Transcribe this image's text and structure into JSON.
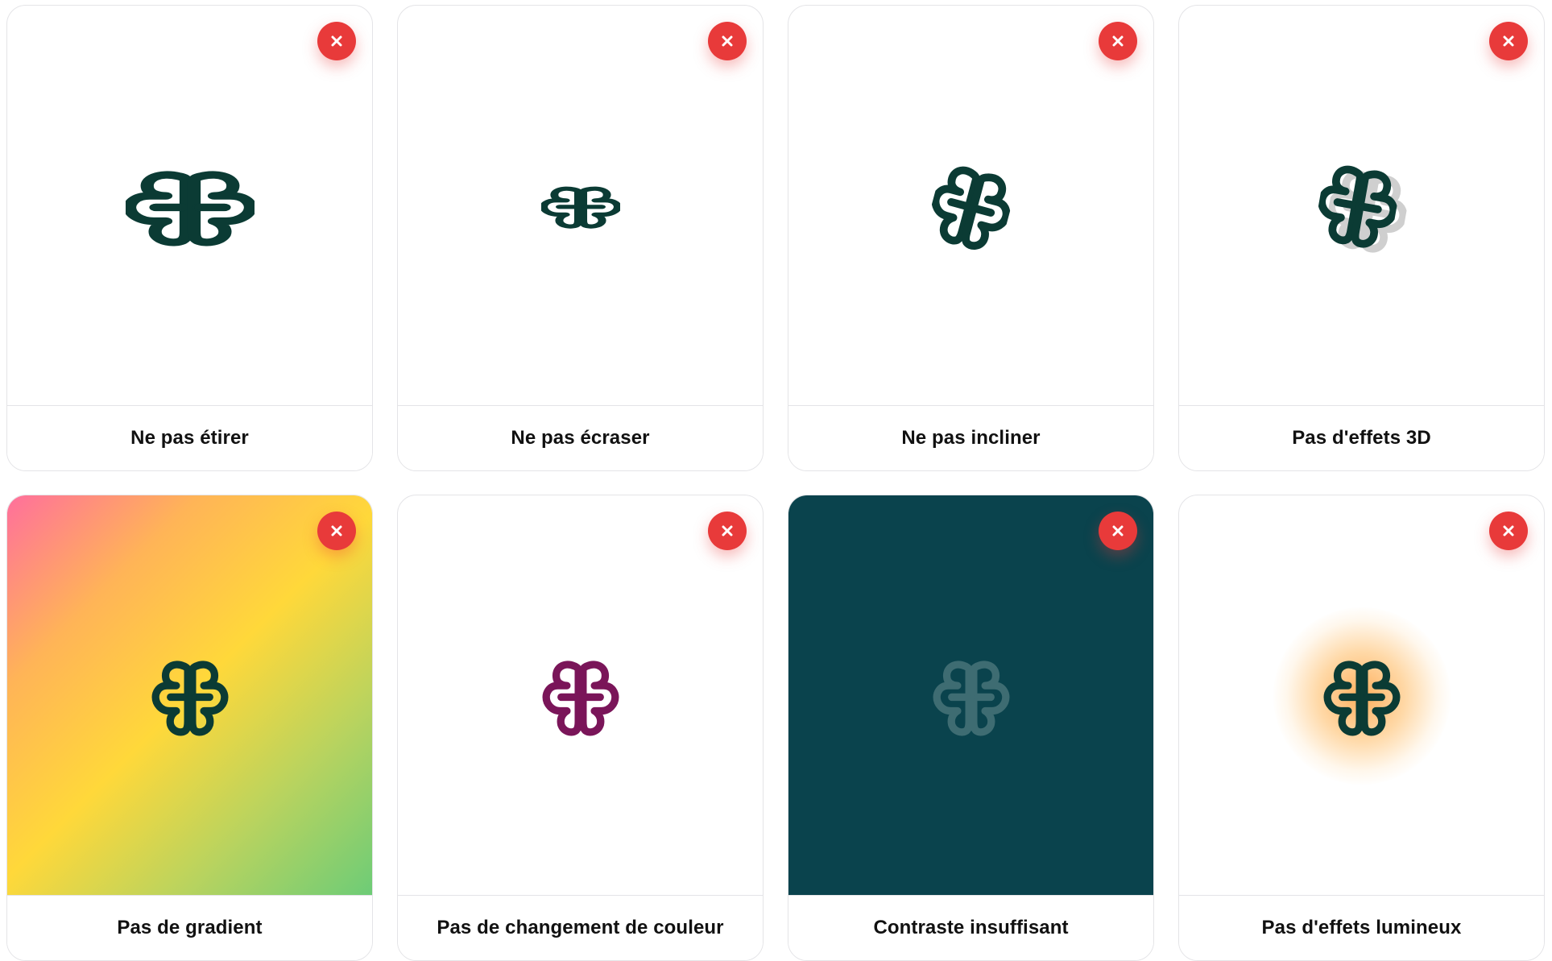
{
  "brand": {
    "logo_color": "#0b3b34",
    "alt_color": "#7a1559",
    "muted_color": "#3e6c72",
    "close_color": "#e83a3a"
  },
  "close_icon": "close-icon",
  "cards": [
    {
      "label": "Ne pas étirer"
    },
    {
      "label": "Ne pas écraser"
    },
    {
      "label": "Ne pas incliner"
    },
    {
      "label": "Pas d'effets 3D"
    },
    {
      "label": "Pas de gradient"
    },
    {
      "label": "Pas de changement de couleur"
    },
    {
      "label": "Contraste insuffisant"
    },
    {
      "label": "Pas d'effets lumineux"
    }
  ]
}
